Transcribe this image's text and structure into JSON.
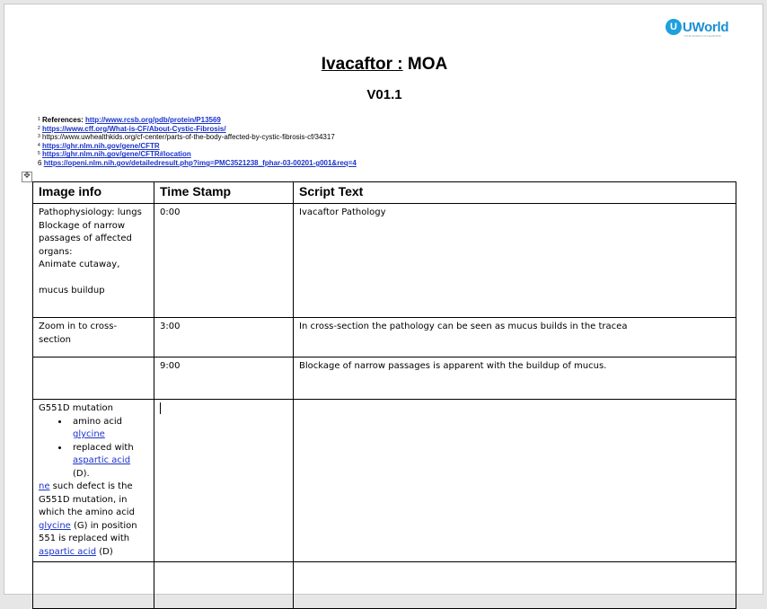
{
  "logo": {
    "brand": "UWorld",
    "tagline": "YOUR WORLD OF LEARNING",
    "mark_color": "#1ea0dc"
  },
  "title": {
    "drug": "Ivacaftor :",
    "suffix": " MOA"
  },
  "version": "V01.1",
  "references": [
    {
      "num": "1",
      "prefix": "References: ",
      "link": "http://www.rcsb.org/pdb/protein/P13569"
    },
    {
      "num": "2",
      "prefix": "",
      "link": "https://www.cff.org/What-is-CF/About-Cystic-Fibrosis/"
    },
    {
      "num": "3",
      "prefix": "",
      "text": "https://www.uwhealthkids.org/cf-center/parts-of-the-body-affected-by-cystic-fibrosis-cf/34317"
    },
    {
      "num": "4",
      "prefix": "",
      "link": "https://ghr.nlm.nih.gov/gene/CFTR"
    },
    {
      "num": "5",
      "prefix": "",
      "link": "https://ghr.nlm.nih.gov/gene/CFTR#location"
    },
    {
      "num": "6",
      "prefix": "",
      "link": "https://openi.nlm.nih.gov/detailedresult.php?img=PMC3521238_fphar-03-00201-g001&req=4"
    }
  ],
  "table": {
    "headers": [
      "Image info",
      "Time Stamp",
      "Script Text"
    ],
    "rows": [
      {
        "image_lines": [
          "Pathophysiology: lungs",
          "Blockage of narrow passages of affected organs:",
          "Animate cutaway,",
          "",
          "mucus buildup"
        ],
        "time": "0:00",
        "script": "Ivacaftor Pathology"
      },
      {
        "image_lines": [
          "Zoom in to cross-section"
        ],
        "time": "3:00",
        "script": "In cross-section the pathology can be seen as mucus builds in the tracea"
      },
      {
        "image_lines": [],
        "time": "9:00",
        "script": "Blockage of narrow passages is apparent with the buildup of mucus."
      },
      {
        "mutation": {
          "heading": "G551D mutation",
          "bullet1_text": "amino acid",
          "bullet1_link": "glycine",
          "bullet2_text": "replaced with",
          "bullet2_link": "aspartic acid",
          "bullet2_after": " (D).",
          "para_link1": "ne",
          "para_text1": " such defect is the G551D mutation, in which the amino acid ",
          "para_link2": "glycine",
          "para_text2": " (G) in position 551 is replaced with ",
          "para_link3": "aspartic acid",
          "para_text3": " (D)"
        },
        "time": "",
        "script": ""
      },
      {
        "image_lines": [],
        "time": "",
        "script": ""
      }
    ]
  }
}
